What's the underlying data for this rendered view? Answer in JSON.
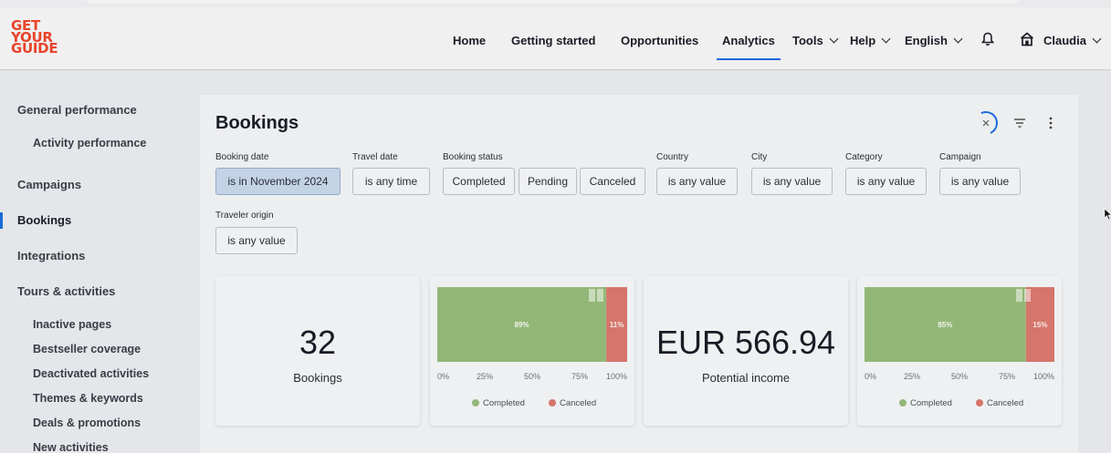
{
  "logo": {
    "lines": [
      "GET",
      "YOUR",
      "GUIDE"
    ]
  },
  "nav": {
    "items": [
      {
        "label": "Home",
        "active": false,
        "dropdown": false
      },
      {
        "label": "Getting started",
        "active": false,
        "dropdown": false
      },
      {
        "label": "Opportunities",
        "active": false,
        "dropdown": false
      },
      {
        "label": "Analytics",
        "active": true,
        "dropdown": false
      },
      {
        "label": "Tools",
        "active": false,
        "dropdown": true
      },
      {
        "label": "Help",
        "active": false,
        "dropdown": true
      },
      {
        "label": "English",
        "active": false,
        "dropdown": true
      }
    ],
    "icons": [
      "bell-icon",
      "home-icon"
    ],
    "user_label": "Claudia"
  },
  "sidebar": {
    "items": [
      {
        "label": "General performance",
        "sub": false
      },
      {
        "label": "Activity performance",
        "sub": true
      },
      {
        "label": "Campaigns",
        "sub": false
      },
      {
        "label": "Bookings",
        "sub": false,
        "active": true
      },
      {
        "label": "Integrations",
        "sub": false
      },
      {
        "label": "Tours & activities",
        "sub": false
      },
      {
        "label": "Inactive pages",
        "sub": true
      },
      {
        "label": "Bestseller coverage",
        "sub": true
      },
      {
        "label": "Deactivated activities",
        "sub": true
      },
      {
        "label": "Themes & keywords",
        "sub": true
      },
      {
        "label": "Deals & promotions",
        "sub": true
      },
      {
        "label": "New activities",
        "sub": true
      }
    ]
  },
  "panel": {
    "title": "Bookings",
    "icons": [
      "close-icon",
      "filter-icon",
      "more-vertical-icon"
    ],
    "filters": {
      "booking_date": {
        "label": "Booking date",
        "value": "is in November 2024"
      },
      "travel_date": {
        "label": "Travel date",
        "value": "is any time"
      },
      "booking_status": {
        "label": "Booking status",
        "values": [
          "Completed",
          "Pending",
          "Canceled"
        ]
      },
      "country": {
        "label": "Country",
        "value": "is any value"
      },
      "city": {
        "label": "City",
        "value": "is any value"
      },
      "category": {
        "label": "Category",
        "value": "is any value"
      },
      "campaign": {
        "label": "Campaign",
        "value": "is any value"
      },
      "traveler_origin": {
        "label": "Traveler origin",
        "value": "is any value"
      }
    },
    "cards": {
      "bookings": {
        "value": "32",
        "label": "Bookings"
      },
      "income": {
        "value": "EUR 566.94",
        "label": "Potential income"
      }
    }
  },
  "colors": {
    "completed": "#93b777",
    "canceled": "#d5756b",
    "accent": "#1a6ad9",
    "logo": "#e8442b"
  },
  "chart_data": [
    {
      "type": "bar",
      "orientation": "horizontal-stacked",
      "categories": [
        "Bookings"
      ],
      "series": [
        {
          "name": "Completed",
          "values": [
            89
          ],
          "label": "89%"
        },
        {
          "name": "Canceled",
          "values": [
            11
          ],
          "label": "11%"
        }
      ],
      "xticks": [
        "0%",
        "25%",
        "50%",
        "75%",
        "100%"
      ],
      "xlim": [
        0,
        100
      ],
      "legend": "bottom"
    },
    {
      "type": "bar",
      "orientation": "horizontal-stacked",
      "categories": [
        "Potential income"
      ],
      "series": [
        {
          "name": "Completed",
          "values": [
            85
          ],
          "label": "85%"
        },
        {
          "name": "Canceled",
          "values": [
            15
          ],
          "label": "15%"
        }
      ],
      "xticks": [
        "0%",
        "25%",
        "50%",
        "75%",
        "100%"
      ],
      "xlim": [
        0,
        100
      ],
      "legend": "bottom"
    }
  ]
}
